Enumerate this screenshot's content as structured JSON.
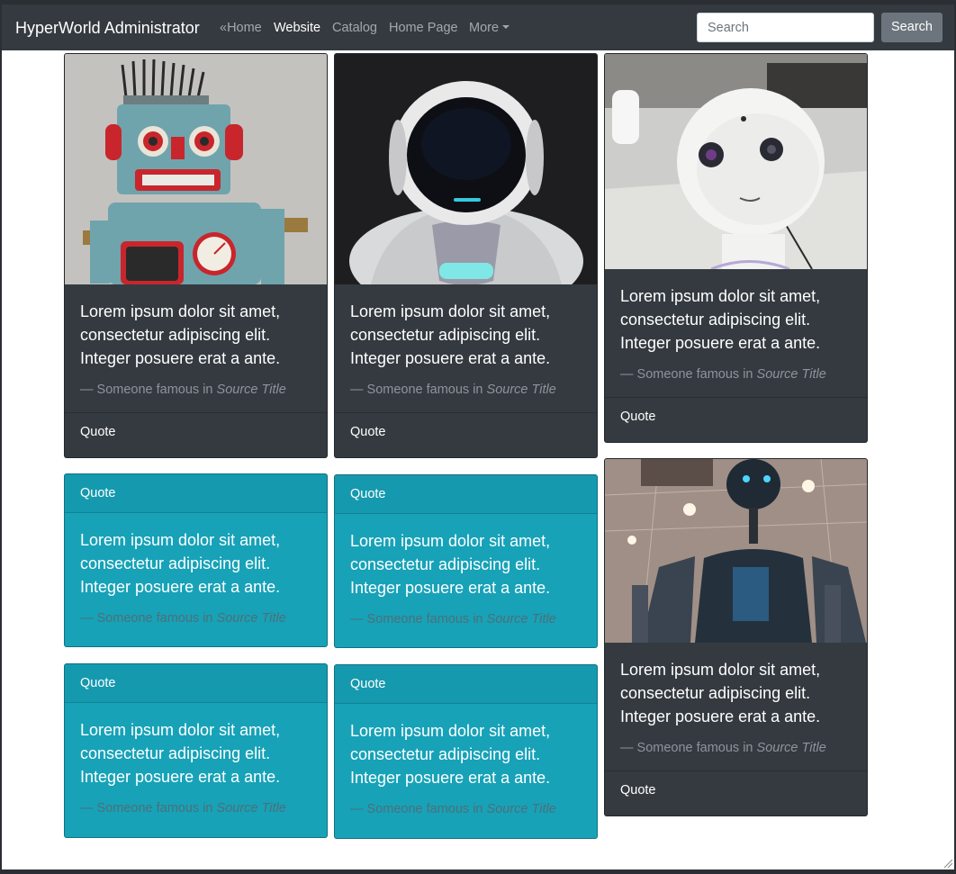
{
  "navbar": {
    "brand": "HyperWorld Administrator",
    "links": [
      {
        "label": "«Home",
        "active": false
      },
      {
        "label": "Website",
        "active": true
      },
      {
        "label": "Catalog",
        "active": false
      },
      {
        "label": "Home Page",
        "active": false
      },
      {
        "label": "More",
        "active": false,
        "dropdown": true
      }
    ],
    "search_placeholder": "Search",
    "search_button": "Search"
  },
  "cards": [
    {
      "style": "dark",
      "image": "retro-tin-robot-photo",
      "text": "Lorem ipsum dolor sit amet, consectetur adipiscing elit. Integer posuere erat a ante.",
      "footer_prefix": "— Someone famous in ",
      "footer_source": "Source Title",
      "label": "Quote"
    },
    {
      "style": "dark",
      "image": "white-helmet-robot-photo",
      "text": "Lorem ipsum dolor sit amet, consectetur adipiscing elit. Integer posuere erat a ante.",
      "footer_prefix": "— Someone famous in ",
      "footer_source": "Source Title",
      "label": "Quote"
    },
    {
      "style": "dark",
      "image": "white-humanoid-robot-photo",
      "text": "Lorem ipsum dolor sit amet, consectetur adipiscing elit. Integer posuere erat a ante.",
      "footer_prefix": "— Someone famous in ",
      "footer_source": "Source Title",
      "label": "Quote"
    },
    {
      "style": "info",
      "text": "Lorem ipsum dolor sit amet, consectetur adipiscing elit. Integer posuere erat a ante.",
      "footer_prefix": "— Someone famous in ",
      "footer_source": "Source Title",
      "label": "Quote"
    },
    {
      "style": "info",
      "text": "Lorem ipsum dolor sit amet, consectetur adipiscing elit. Integer posuere erat a ante.",
      "footer_prefix": "— Someone famous in ",
      "footer_source": "Source Title",
      "label": "Quote"
    },
    {
      "style": "dark",
      "image": "industrial-robot-photo",
      "text": "Lorem ipsum dolor sit amet, consectetur adipiscing elit. Integer posuere erat a ante.",
      "footer_prefix": "— Someone famous in ",
      "footer_source": "Source Title",
      "label": "Quote"
    },
    {
      "style": "info",
      "text": "Lorem ipsum dolor sit amet, consectetur adipiscing elit. Integer posuere erat a ante.",
      "footer_prefix": "— Someone famous in ",
      "footer_source": "Source Title",
      "label": "Quote"
    },
    {
      "style": "info",
      "text": "Lorem ipsum dolor sit amet, consectetur adipiscing elit. Integer posuere erat a ante.",
      "footer_prefix": "— Someone famous in ",
      "footer_source": "Source Title",
      "label": "Quote"
    }
  ],
  "colors": {
    "navbar": "#343a40",
    "card_dark": "#343a40",
    "card_info": "#17a2b8",
    "search_button": "#6c757d"
  }
}
